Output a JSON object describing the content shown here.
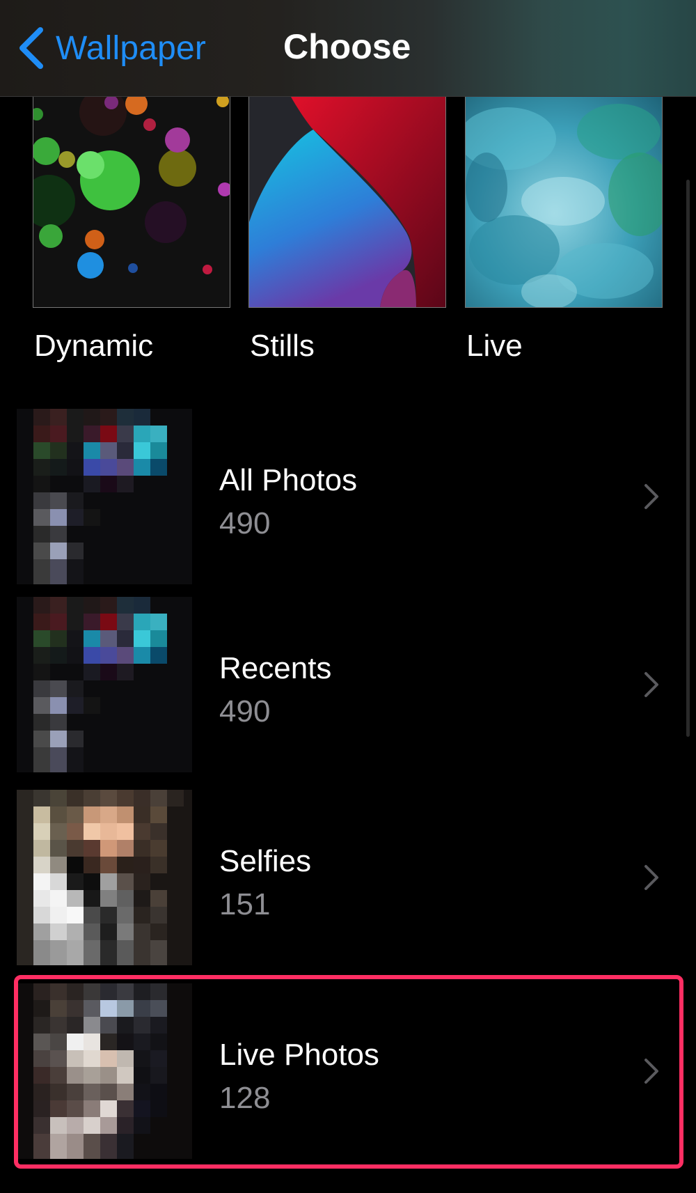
{
  "nav": {
    "back_label": "Wallpaper",
    "title": "Choose"
  },
  "categories": [
    {
      "label": "Dynamic"
    },
    {
      "label": "Stills"
    },
    {
      "label": "Live"
    }
  ],
  "albums": [
    {
      "title": "All Photos",
      "count": "490"
    },
    {
      "title": "Recents",
      "count": "490"
    },
    {
      "title": "Selfies",
      "count": "151"
    },
    {
      "title": "Live Photos",
      "count": "128"
    }
  ],
  "colors": {
    "accent": "#1f8df6",
    "highlight": "#ff2e63",
    "secondary_text": "#8e8e93"
  },
  "icons": {
    "back": "chevron-left-icon",
    "disclosure": "chevron-right-icon"
  }
}
